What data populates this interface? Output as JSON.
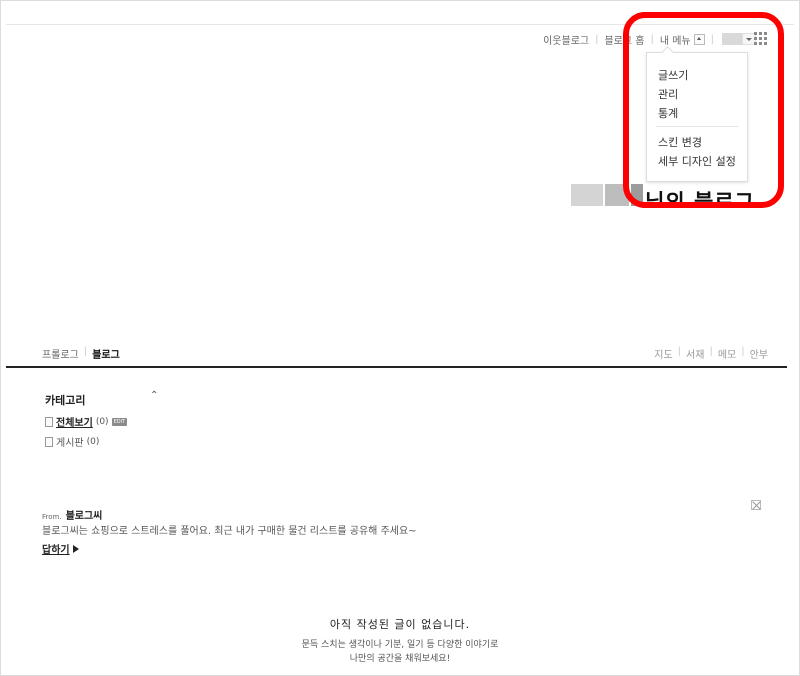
{
  "gnb": {
    "neighbor_blog": "이웃블로그",
    "blog_home": "블로그 홈",
    "my_menu": "내 메뉴",
    "grid_icon": "grid-icon"
  },
  "dropdown": {
    "items": [
      "글쓰기",
      "관리",
      "통계",
      "스킨 변경",
      "세부 디자인 설정"
    ]
  },
  "header": {
    "title": "님의 블로그"
  },
  "nav": {
    "left": [
      "프롤로그",
      "블로그"
    ],
    "right": [
      "지도",
      "서재",
      "메모",
      "안부"
    ]
  },
  "category": {
    "title": "카테고리",
    "items": [
      {
        "label": "전체보기",
        "count": "(0)",
        "badge": "EDIT"
      },
      {
        "label": "게시판",
        "count": "(0)"
      }
    ]
  },
  "from": {
    "label": "From.",
    "name": "블로그씨",
    "desc": "블로그씨는 쇼핑으로 스트레스를 풀어요. 최근 내가 구매한 물건 리스트를 공유해 주세요~",
    "reply": "답하기"
  },
  "empty": {
    "title": "아직 작성된 글이 없습니다.",
    "line1": "문득 스치는 생각이나 기분, 일기 등 다양한 이야기로",
    "line2": "나만의 공간을 채워보세요!"
  },
  "colors": {
    "highlight": "#ff0000"
  }
}
